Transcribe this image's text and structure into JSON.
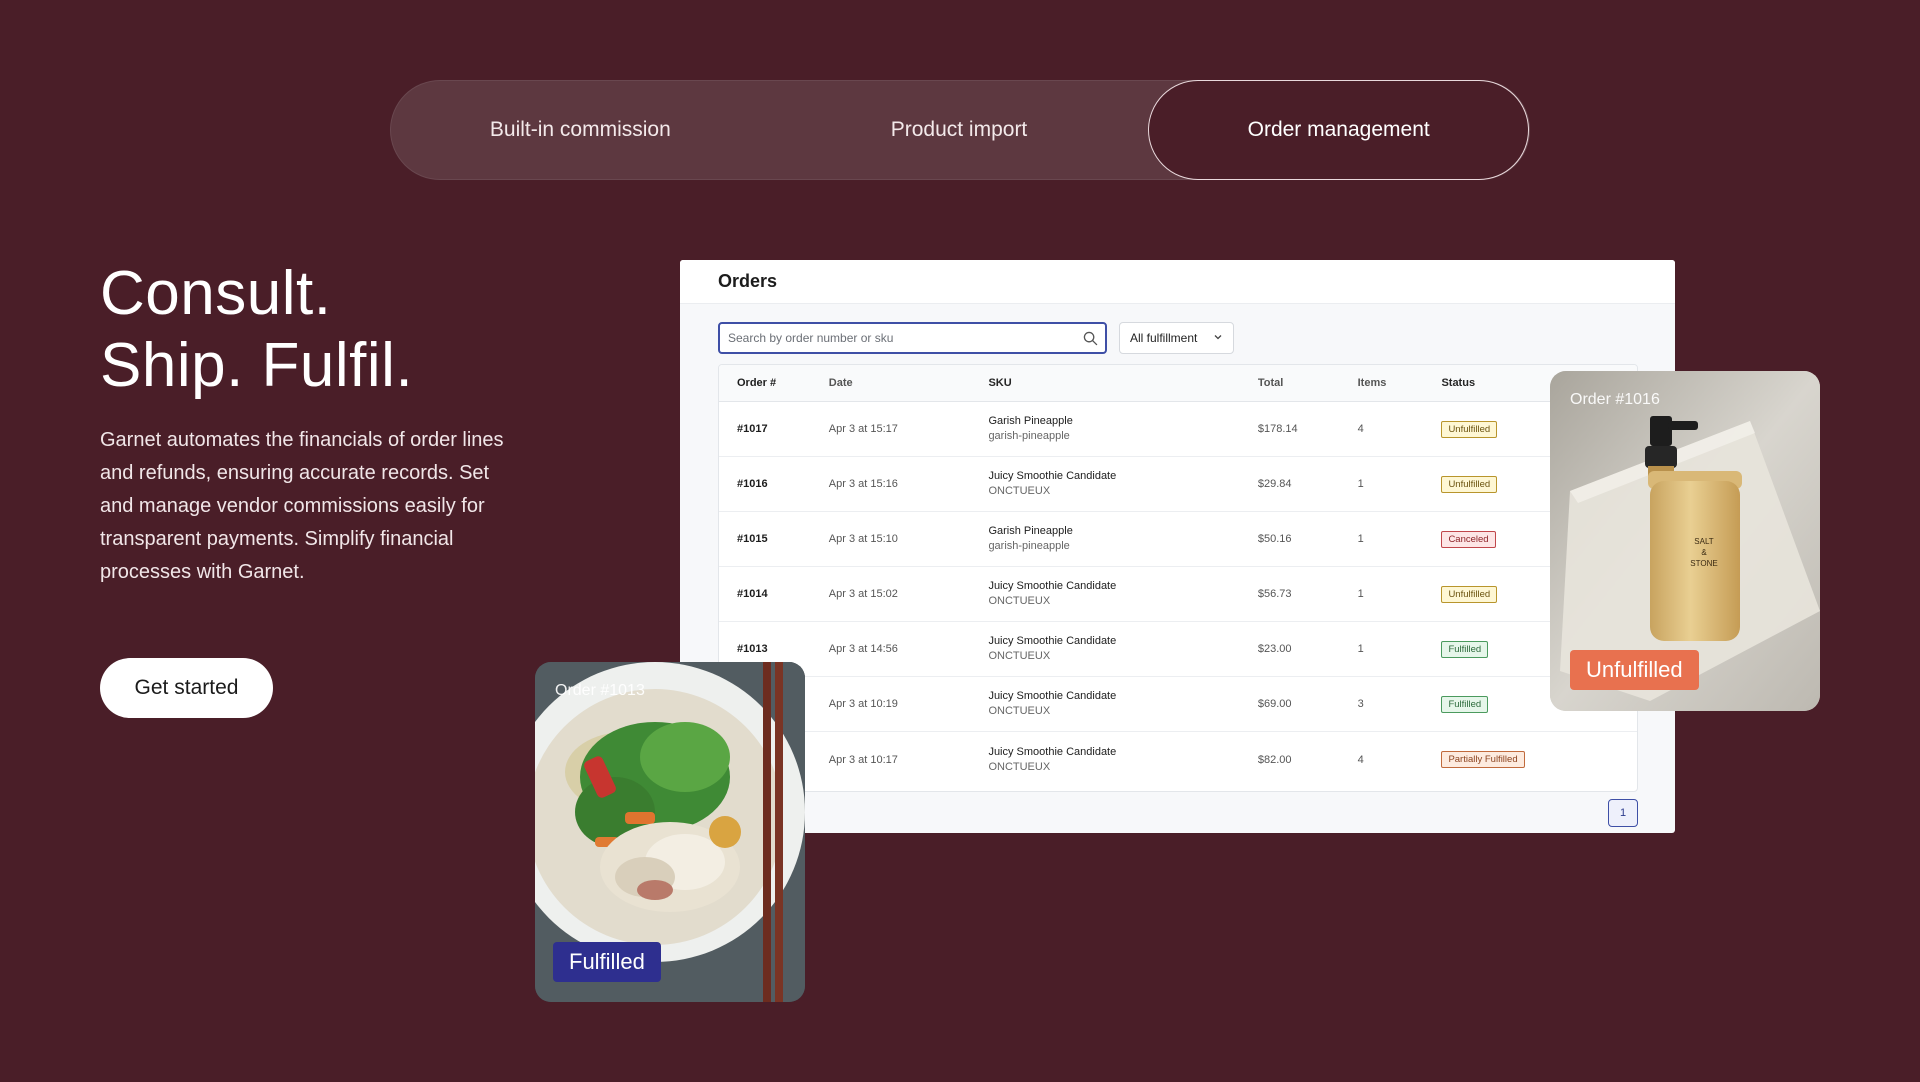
{
  "tabs": [
    {
      "label": "Built-in commission",
      "active": false
    },
    {
      "label": "Product import",
      "active": false
    },
    {
      "label": "Order management",
      "active": true
    }
  ],
  "hero": {
    "title_line1": "Consult.",
    "title_line2": "Ship. Fulfil.",
    "description": "Garnet automates the financials of order lines and refunds, ensuring accurate records. Set and manage vendor commissions easily for transparent payments. Simplify financial processes with Garnet.",
    "cta_label": "Get started"
  },
  "orders": {
    "title": "Orders",
    "search_placeholder": "Search by order number or sku",
    "filter_value": "All fulfillment",
    "columns": [
      "Order #",
      "Date",
      "SKU",
      "Total",
      "Items",
      "Status"
    ],
    "rows": [
      {
        "order": "#1017",
        "date": "Apr 3 at 15:17",
        "sku_name": "Garish Pineapple",
        "sku_code": "garish-pineapple",
        "total": "$178.14",
        "items": "4",
        "status": "Unfulfilled"
      },
      {
        "order": "#1016",
        "date": "Apr 3 at 15:16",
        "sku_name": "Juicy Smoothie Candidate",
        "sku_code": "ONCTUEUX",
        "total": "$29.84",
        "items": "1",
        "status": "Unfulfilled"
      },
      {
        "order": "#1015",
        "date": "Apr 3 at 15:10",
        "sku_name": "Garish Pineapple",
        "sku_code": "garish-pineapple",
        "total": "$50.16",
        "items": "1",
        "status": "Canceled"
      },
      {
        "order": "#1014",
        "date": "Apr 3 at 15:02",
        "sku_name": "Juicy Smoothie Candidate",
        "sku_code": "ONCTUEUX",
        "total": "$56.73",
        "items": "1",
        "status": "Unfulfilled"
      },
      {
        "order": "#1013",
        "date": "Apr 3 at 14:56",
        "sku_name": "Juicy Smoothie Candidate",
        "sku_code": "ONCTUEUX",
        "total": "$23.00",
        "items": "1",
        "status": "Fulfilled"
      },
      {
        "order": "",
        "date": "Apr 3 at 10:19",
        "sku_name": "Juicy Smoothie Candidate",
        "sku_code": "ONCTUEUX",
        "total": "$69.00",
        "items": "3",
        "status": "Fulfilled"
      },
      {
        "order": "",
        "date": "Apr 3 at 10:17",
        "sku_name": "Juicy Smoothie Candidate",
        "sku_code": "ONCTUEUX",
        "total": "$82.00",
        "items": "4",
        "status": "Partially Fulfilled"
      }
    ],
    "page": "1"
  },
  "cards": {
    "left": {
      "label": "Order #1013",
      "status": "Fulfilled",
      "status_color": "#2e2f8f"
    },
    "right": {
      "label": "Order #1016",
      "status": "Unfulfilled",
      "status_color": "#e8714f",
      "product_text_line1": "SALT",
      "product_text_line2": "&",
      "product_text_line3": "STONE"
    }
  },
  "colors": {
    "background": "#4a1e28",
    "tab_bar": "#5d3840",
    "search_focus": "#3e4fa6"
  }
}
